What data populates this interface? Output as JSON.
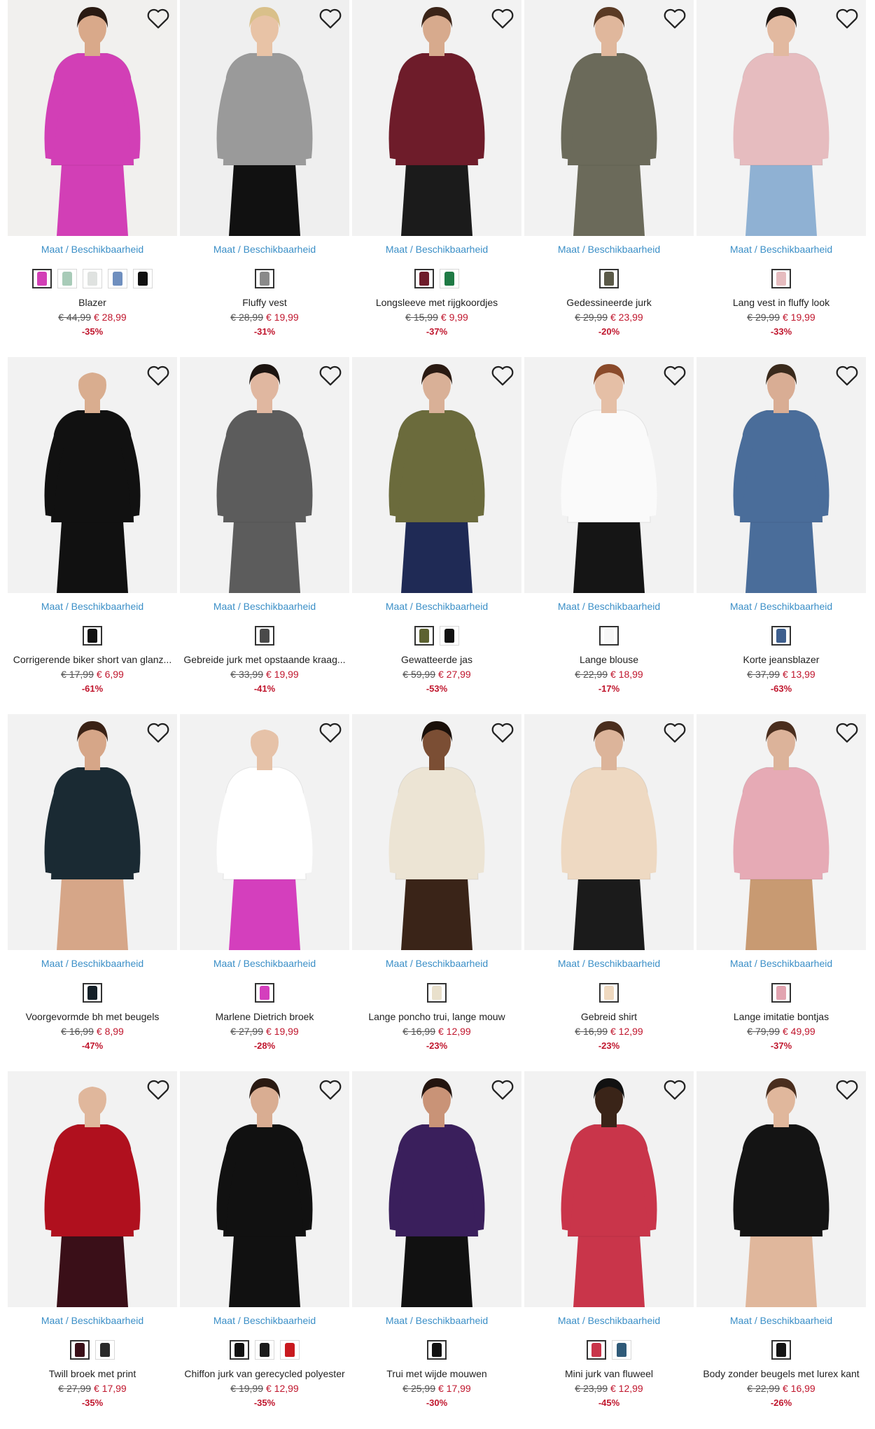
{
  "products": [
    {
      "size_label": "Maat / Beschikbaarheid",
      "name": "Blazer",
      "old_price": "€ 44,99",
      "new_price": "€ 28,99",
      "discount": "-35%",
      "bg": "#f1f0ee",
      "garment": "#d23fb6",
      "skin": "#d9a98a",
      "hair": "#2a1a12",
      "lower": "#d23fb6",
      "swatches": [
        "#d23fb6",
        "#a8cbb8",
        "#dfe2e0",
        "#6f8fbf",
        "#111111"
      ]
    },
    {
      "size_label": "Maat / Beschikbaarheid",
      "name": "Fluffy vest",
      "old_price": "€ 28,99",
      "new_price": "€ 19,99",
      "discount": "-31%",
      "bg": "#efefef",
      "garment": "#9a9a9a",
      "skin": "#e8c3a6",
      "hair": "#d9c08a",
      "lower": "#111111",
      "swatches": [
        "#8a8a8a"
      ]
    },
    {
      "size_label": "Maat / Beschikbaarheid",
      "name": "Longsleeve met rijgkoordjes",
      "old_price": "€ 15,99",
      "new_price": "€ 9,99",
      "discount": "-37%",
      "bg": "#f2f2f2",
      "garment": "#6e1c2a",
      "skin": "#d7aa8d",
      "hair": "#3b2418",
      "lower": "#1b1b1b",
      "swatches": [
        "#6e1c2a",
        "#1f7a45"
      ]
    },
    {
      "size_label": "Maat / Beschikbaarheid",
      "name": "Gedessineerde jurk",
      "old_price": "€ 29,99",
      "new_price": "€ 23,99",
      "discount": "-20%",
      "bg": "#f2f2f2",
      "garment": "#6b6a5a",
      "skin": "#e0b79c",
      "hair": "#5a3a24",
      "lower": "#6b6a5a",
      "swatches": [
        "#5b5a48"
      ]
    },
    {
      "size_label": "Maat / Beschikbaarheid",
      "name": "Lang vest in fluffy look",
      "old_price": "€ 29,99",
      "new_price": "€ 19,99",
      "discount": "-33%",
      "bg": "#f3f3f3",
      "garment": "#e6bcbf",
      "skin": "#e2b9a0",
      "hair": "#1c1410",
      "lower": "#8fb1d3",
      "swatches": [
        "#e6bcbf"
      ]
    },
    {
      "size_label": "Maat / Beschikbaarheid",
      "name": "Corrigerende biker short van glanz...",
      "old_price": "€ 17,99",
      "new_price": "€ 6,99",
      "discount": "-61%",
      "bg": "#f2f2f2",
      "garment": "#111111",
      "skin": "#d9ad8f",
      "hair": "#f2f2f2",
      "lower": "#111111",
      "swatches": [
        "#111111"
      ]
    },
    {
      "size_label": "Maat / Beschikbaarheid",
      "name": "Gebreide jurk met opstaande kraag...",
      "old_price": "€ 33,99",
      "new_price": "€ 19,99",
      "discount": "-41%",
      "bg": "#f2f2f2",
      "garment": "#5c5c5c",
      "skin": "#e0b7a0",
      "hair": "#1c1410",
      "lower": "#5c5c5c",
      "swatches": [
        "#4a4a4a"
      ]
    },
    {
      "size_label": "Maat / Beschikbaarheid",
      "name": "Gewatteerde jas",
      "old_price": "€ 59,99",
      "new_price": "€ 27,99",
      "discount": "-53%",
      "bg": "#f2f2f2",
      "garment": "#6b6b3c",
      "skin": "#d9b097",
      "hair": "#2a1a12",
      "lower": "#1f2a55",
      "swatches": [
        "#5d6231",
        "#111111"
      ]
    },
    {
      "size_label": "Maat / Beschikbaarheid",
      "name": "Lange blouse",
      "old_price": "€ 22,99",
      "new_price": "€ 18,99",
      "discount": "-17%",
      "bg": "#f2f2f2",
      "garment": "#fafafa",
      "skin": "#e5bfa6",
      "hair": "#8a4a2a",
      "lower": "#151515",
      "swatches": [
        "#f7f7f7"
      ]
    },
    {
      "size_label": "Maat / Beschikbaarheid",
      "name": "Korte jeansblazer",
      "old_price": "€ 37,99",
      "new_price": "€ 13,99",
      "discount": "-63%",
      "bg": "#f2f2f2",
      "garment": "#4a6d9a",
      "skin": "#d9ad94",
      "hair": "#3a2a1c",
      "lower": "#4a6d9a",
      "swatches": [
        "#3e5f8e"
      ]
    },
    {
      "size_label": "Maat / Beschikbaarheid",
      "name": "Voorgevormde bh met beugels",
      "old_price": "€ 16,99",
      "new_price": "€ 8,99",
      "discount": "-47%",
      "bg": "#f2f2f2",
      "garment": "#1a2a33",
      "skin": "#d6a688",
      "hair": "#3a2216",
      "lower": "#d6a688",
      "swatches": [
        "#152028"
      ]
    },
    {
      "size_label": "Maat / Beschikbaarheid",
      "name": "Marlene Dietrich broek",
      "old_price": "€ 27,99",
      "new_price": "€ 19,99",
      "discount": "-28%",
      "bg": "#f2f2f2",
      "garment": "#ffffff",
      "skin": "#e6c2a8",
      "hair": "#f2f2f2",
      "lower": "#d43fbd",
      "swatches": [
        "#d43fbd"
      ]
    },
    {
      "size_label": "Maat / Beschikbaarheid",
      "name": "Lange poncho trui, lange mouw",
      "old_price": "€ 16,99",
      "new_price": "€ 12,99",
      "discount": "-23%",
      "bg": "#f2f2f2",
      "garment": "#ece4d4",
      "skin": "#7b4e34",
      "hair": "#1a100a",
      "lower": "#3a2418",
      "swatches": [
        "#e9e0cc"
      ]
    },
    {
      "size_label": "Maat / Beschikbaarheid",
      "name": "Gebreid shirt",
      "old_price": "€ 16,99",
      "new_price": "€ 12,99",
      "discount": "-23%",
      "bg": "#f2f2f2",
      "garment": "#eed9c2",
      "skin": "#dcb49a",
      "hair": "#4a2e1e",
      "lower": "#1b1b1b",
      "swatches": [
        "#efd9c0"
      ]
    },
    {
      "size_label": "Maat / Beschikbaarheid",
      "name": "Lange imitatie bontjas",
      "old_price": "€ 79,99",
      "new_price": "€ 49,99",
      "discount": "-37%",
      "bg": "#f3f3f3",
      "garment": "#e6aab5",
      "skin": "#dcb39a",
      "hair": "#4a2e1e",
      "lower": "#c89a72",
      "swatches": [
        "#e2a4b0"
      ]
    },
    {
      "size_label": "Maat / Beschikbaarheid",
      "name": "Twill broek met print",
      "old_price": "€ 27,99",
      "new_price": "€ 17,99",
      "discount": "-35%",
      "bg": "#f2f2f2",
      "garment": "#b0101e",
      "skin": "#e0b79c",
      "hair": "#f2f2f2",
      "lower": "#3a0f18",
      "swatches": [
        "#3a0f18",
        "#2a2a2a"
      ]
    },
    {
      "size_label": "Maat / Beschikbaarheid",
      "name": "Chiffon jurk van gerecycled polyester",
      "old_price": "€ 19,99",
      "new_price": "€ 12,99",
      "discount": "-35%",
      "bg": "#f2f2f2",
      "garment": "#111111",
      "skin": "#d9ad92",
      "hair": "#2a1a12",
      "lower": "#111111",
      "swatches": [
        "#111111",
        "#1a1a1a",
        "#c8191e"
      ]
    },
    {
      "size_label": "Maat / Beschikbaarheid",
      "name": "Trui met wijde mouwen",
      "old_price": "€ 25,99",
      "new_price": "€ 17,99",
      "discount": "-30%",
      "bg": "#f2f2f2",
      "garment": "#3a1f5c",
      "skin": "#c99377",
      "hair": "#241510",
      "lower": "#111111",
      "swatches": [
        "#111111"
      ]
    },
    {
      "size_label": "Maat / Beschikbaarheid",
      "name": "Mini jurk van fluweel",
      "old_price": "€ 23,99",
      "new_price": "€ 12,99",
      "discount": "-45%",
      "bg": "#f2f2f2",
      "garment": "#c9354a",
      "skin": "#3a2418",
      "hair": "#111111",
      "lower": "#c9354a",
      "swatches": [
        "#c9354a",
        "#2f5a78"
      ]
    },
    {
      "size_label": "Maat / Beschikbaarheid",
      "name": "Body zonder beugels met lurex kant",
      "old_price": "€ 22,99",
      "new_price": "€ 16,99",
      "discount": "-26%",
      "bg": "#f2f2f2",
      "garment": "#141414",
      "skin": "#e0b79c",
      "hair": "#4a2e1e",
      "lower": "#e0b79c",
      "swatches": [
        "#141414"
      ]
    }
  ]
}
